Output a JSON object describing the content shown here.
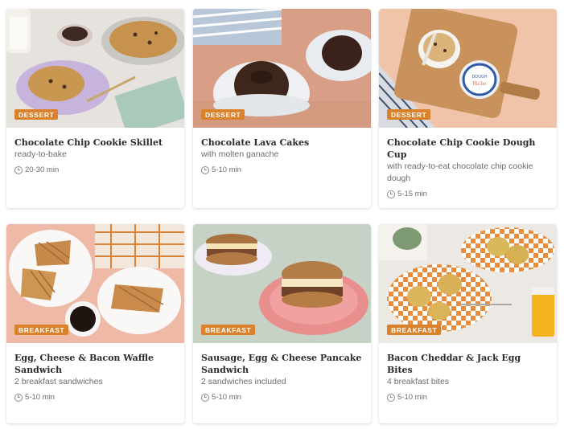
{
  "cards": [
    {
      "badge": "DESSERT",
      "title": "Chocolate Chip Cookie Skillet",
      "subtitle": "ready-to-bake",
      "time": "20-30 min"
    },
    {
      "badge": "DESSERT",
      "title": "Chocolate Lava Cakes",
      "subtitle": "with molten ganache",
      "time": "5-10 min"
    },
    {
      "badge": "DESSERT",
      "title": "Chocolate Chip Cookie Dough Cup",
      "subtitle": "with ready-to-eat chocolate chip cookie dough",
      "time": "5-15 min"
    },
    {
      "badge": "BREAKFAST",
      "title": "Egg, Cheese & Bacon Waffle Sandwich",
      "subtitle": "2 breakfast sandwiches",
      "time": "5-10 min"
    },
    {
      "badge": "BREAKFAST",
      "title": "Sausage, Egg & Cheese Pancake Sandwich",
      "subtitle": "2 sandwiches included",
      "time": "5-10 min"
    },
    {
      "badge": "BREAKFAST",
      "title": "Bacon Cheddar & Jack Egg Bites",
      "subtitle": "4 breakfast bites",
      "time": "5-10 min"
    }
  ],
  "cup_lid_text": "DOUGH Riche",
  "icons": {
    "badge_color": "#d9822b",
    "time_icon": "clock-icon"
  }
}
